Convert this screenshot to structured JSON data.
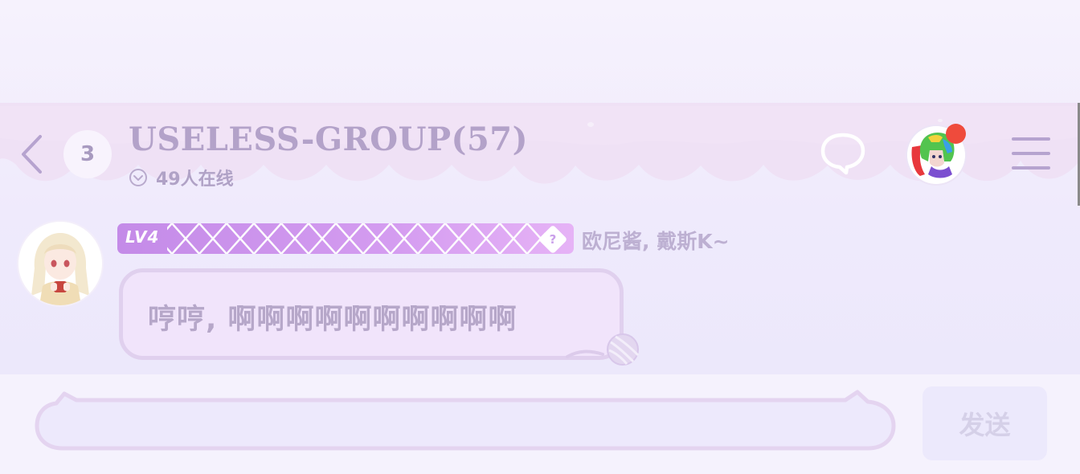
{
  "header": {
    "unread_count": "3",
    "group_title": "USELESS-GROUP(57)",
    "online_status": "49人在线",
    "has_notification": true
  },
  "message": {
    "level_badge": "LV4",
    "level_help": "?",
    "sender_name": "欧尼酱, 戴斯K~",
    "text": "哼哼, 啊啊啊啊啊啊啊啊啊啊"
  },
  "composer": {
    "input_value": "",
    "send_label": "发送"
  },
  "colors": {
    "background": "#f4f0fc",
    "title": "#b3a2c9",
    "icon": "#b6a3cf",
    "level_badge": "#c48be8",
    "bubble_fill": "#f1e4fb",
    "bubble_border": "#e0d0ee",
    "notification_dot": "#ef4b3c",
    "send_button": "#ece9fc"
  },
  "icons": {
    "back": "chevron-left-icon",
    "chat": "speech-bubble-icon",
    "online": "chevron-down-circle-icon",
    "menu": "hamburger-menu-icon"
  }
}
